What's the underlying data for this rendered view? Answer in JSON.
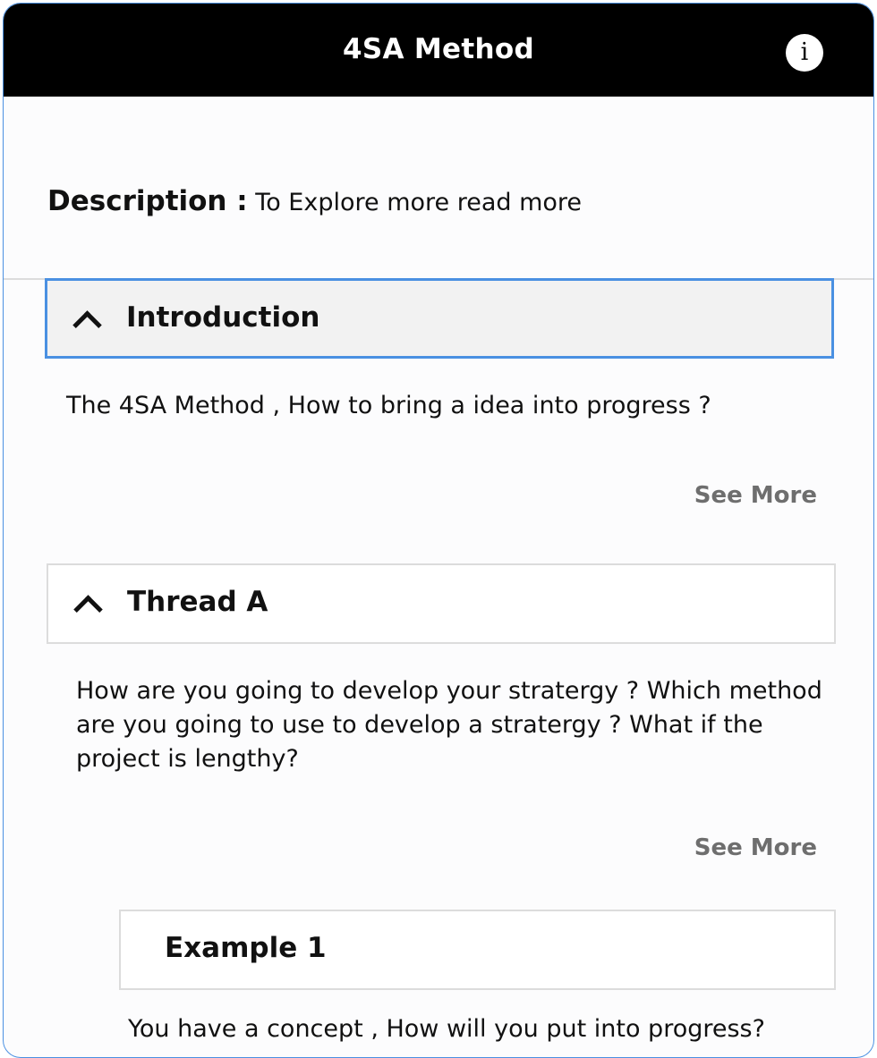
{
  "header": {
    "title": "4SA Method",
    "info_icon_glyph": "i"
  },
  "description": {
    "label": "Description :",
    "text": "To Explore more read more"
  },
  "sections": [
    {
      "title": "Introduction",
      "expanded": true,
      "focused": true,
      "body": "The 4SA Method , How to bring a idea into progress ?",
      "see_more_label": "See More"
    },
    {
      "title": "Thread A",
      "expanded": true,
      "focused": false,
      "body": "How are you going to develop your stratergy ? Which method are you going to use to develop a stratergy ? What if the project is lengthy?",
      "see_more_label": "See More"
    }
  ],
  "example": {
    "title": "Example 1",
    "body": "You have a concept , How will you put into progress?"
  },
  "colors": {
    "header_bg": "#000000",
    "focus_border": "#4a90e2",
    "see_more": "#6e6e6e"
  }
}
